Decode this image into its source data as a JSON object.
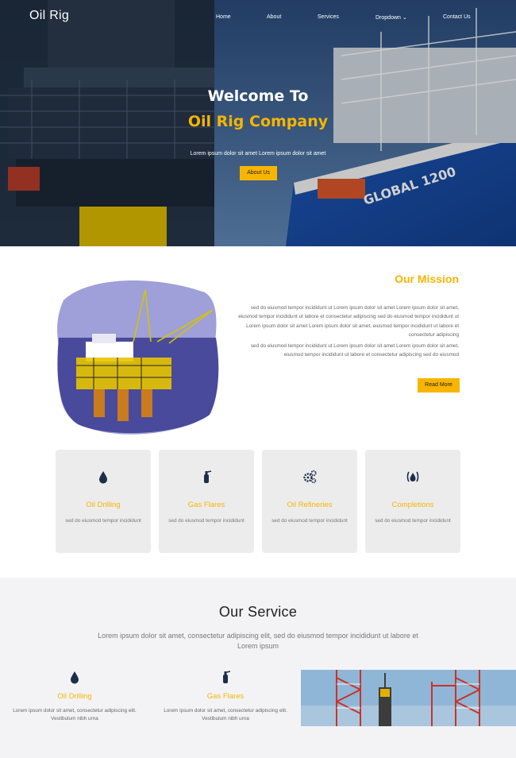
{
  "brand": "Oil Rig",
  "nav": {
    "home": "Home",
    "about": "About",
    "services": "Services",
    "dropdown": "Dropdown",
    "contact": "Contact Us"
  },
  "hero": {
    "title": "Welcome To",
    "company": "Oil Rig Company",
    "subtitle": "Lorem ipsum dolor sit amet Lorem ipsum dolor sit amet",
    "button": "About Us",
    "ship_text": "GLOBAL 1200"
  },
  "mission": {
    "title": "Our Mission",
    "paragraph1": "sed do eiusmod tempor incididunt ut Lorem ipsum dolor sit amet Lorem ipsum dolor sit amet, eiusmod tempor incididunt ut labore et consectetur adipiscing sed do eiusmod tempor incididunt ut Lorem ipsum dolor sit amet Lorem ipsum dolor sit amet, eiusmod tempor incididunt ut labore et consectetur adipiscing",
    "paragraph2": "sed do eiusmod tempor incididunt ut Lorem ipsum dolor sit amet Lorem ipsum dolor sit amet, eiusmod tempor incididunt ut labore et consectetur adipiscing sed do eiusmod",
    "button": "Read More"
  },
  "features": [
    {
      "title": "Oil Drilling",
      "desc": "sed do eiusmod tempor incididunt",
      "icon": "oil-drop-icon"
    },
    {
      "title": "Gas Flares",
      "desc": "sed do eiusmod tempor incididunt",
      "icon": "fire-extinguisher-icon"
    },
    {
      "title": "Oil Refineries",
      "desc": "sed do eiusmod tempor incididunt",
      "icon": "gears-icon"
    },
    {
      "title": "Completions",
      "desc": "sed do eiusmod tempor incididunt",
      "icon": "flame-icon"
    }
  ],
  "service": {
    "title": "Our Service",
    "subtitle": "Lorem ipsum dolor sit amet, consectetur adipiscing elit, sed do eiusmod tempor incididunt ut labore et Lorem ipsum",
    "items": [
      {
        "title": "Oil Drilling",
        "desc": "Lorem ipsum dolor sit amet, consectetur adipiscing elit. Vestibulum nibh urna",
        "icon": "oil-drop-icon"
      },
      {
        "title": "Gas Flares",
        "desc": "Lorem ipsum dolor sit amet, consectetur adipiscing elit. Vestibulum nibh urna",
        "icon": "fire-extinguisher-icon"
      }
    ]
  },
  "colors": {
    "accent": "#f7b500",
    "icon": "#1c2e4a",
    "card_bg": "#ececec",
    "section_bg": "#f3f3f5"
  }
}
